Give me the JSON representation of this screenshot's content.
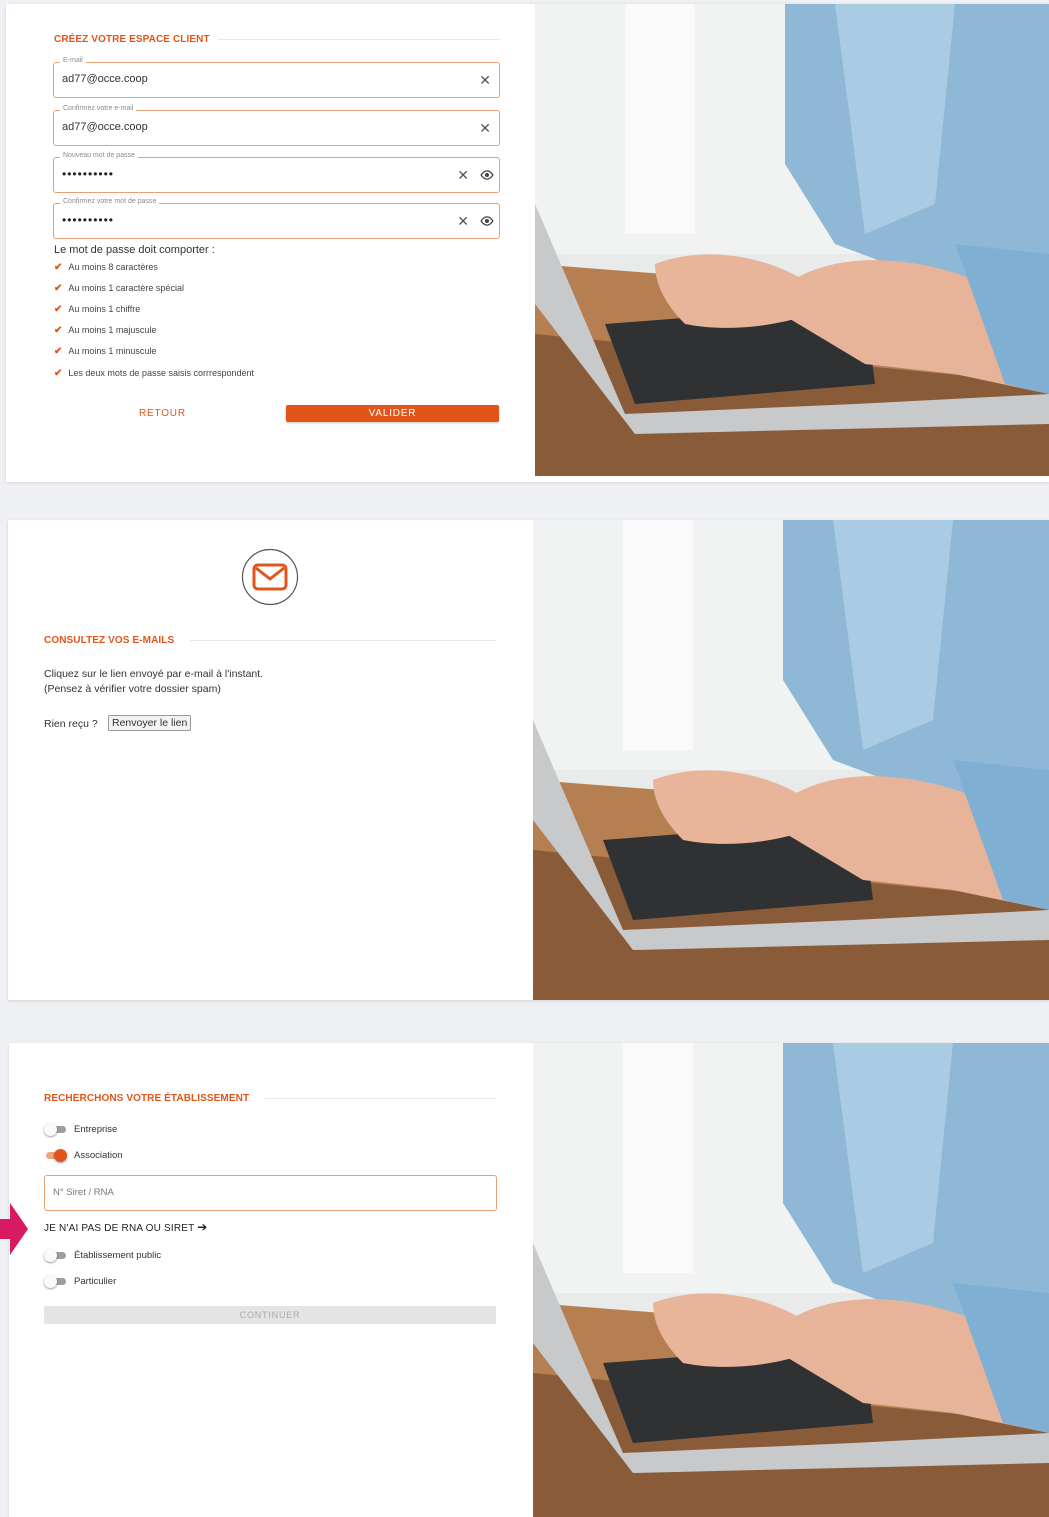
{
  "colors": {
    "accent": "#e2541a",
    "pointer_arrow": "#d81b60"
  },
  "panel1": {
    "title": "CRÉEZ VOTRE ESPACE CLIENT",
    "email": {
      "legend": "E-mail",
      "value": "ad77@occe.coop"
    },
    "email_confirm": {
      "legend": "Confirmez votre e-mail",
      "value": "ad77@occe.coop"
    },
    "password": {
      "legend": "Nouveau mot de passe",
      "value": "••••••••••"
    },
    "password_confirm": {
      "legend": "Confirmez votre mot de passe",
      "value": "••••••••••"
    },
    "rules_title": "Le mot de passe doit comporter :",
    "rules": [
      "Au moins 8 caractères",
      "Au moins 1 caractère spécial",
      "Au moins 1 chiffre",
      "Au moins 1 majuscule",
      "Au moins 1 minuscule",
      "Les deux mots de passe saisis corrrespondent"
    ],
    "back_label": "RETOUR",
    "submit_label": "VALIDER"
  },
  "panel2": {
    "title": "CONSULTEZ VOS E-MAILS",
    "line1": "Cliquez sur le lien envoyé par e-mail à l'instant.",
    "line2": "(Pensez à vérifier votre dossier spam)",
    "not_received": "Rien reçu ?",
    "resend_label": "Renvoyer le lien",
    "icon": "envelope-icon"
  },
  "panel3": {
    "title": "RECHERCHONS VOTRE ÉTABLISSEMENT",
    "toggle_entreprise": "Entreprise",
    "toggle_association": "Association",
    "siret_placeholder": "N° Siret / RNA",
    "no_rna_link": "JE N'AI PAS DE RNA OU SIRET",
    "toggle_public": "Établissement public",
    "toggle_particulier": "Particulier",
    "continue_label": "CONTINUER"
  }
}
